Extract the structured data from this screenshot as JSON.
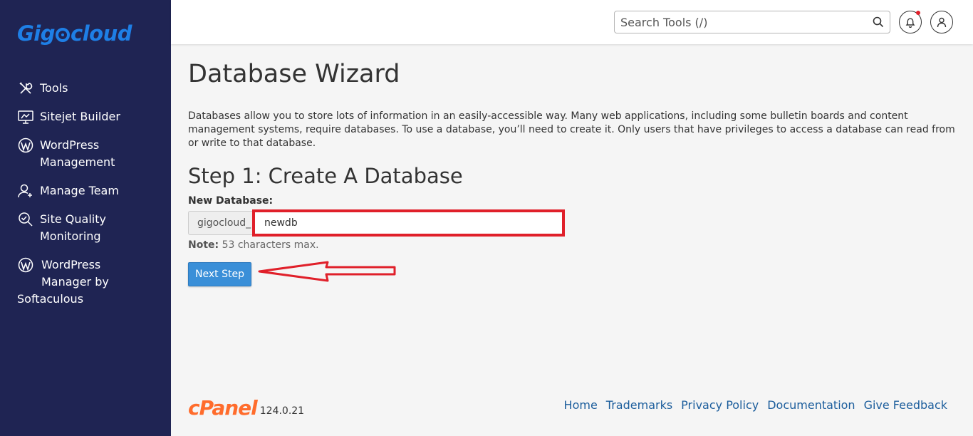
{
  "brand": {
    "logo_pre": "Gig",
    "logo_post": "cloud"
  },
  "sidebar": {
    "items": [
      {
        "label": "Tools",
        "icon": "tools-icon"
      },
      {
        "label": "Sitejet Builder",
        "icon": "sitejet-icon"
      },
      {
        "label_line1": "WordPress",
        "label_line2": "Management",
        "icon": "wordpress-icon"
      },
      {
        "label": "Manage Team",
        "icon": "manage-team-icon"
      },
      {
        "label_line1": "Site Quality",
        "label_line2": "Monitoring",
        "icon": "site-quality-icon"
      },
      {
        "label_line1": "WordPress",
        "label_line2": "Manager by",
        "label_line3": "Softaculous",
        "icon": "wordpress-icon"
      }
    ]
  },
  "header": {
    "search_placeholder": "Search Tools (/)",
    "notification_icon": "bell-icon",
    "user_icon": "user-icon",
    "notification_dot_color": "#e0202a"
  },
  "main": {
    "title": "Database Wizard",
    "description": "Databases allow you to store lots of information in an easily-accessible way. Many web applications, including some bulletin boards and content management systems, require databases. To use a database, you’ll need to create it. Only users that have privileges to access a database can read from or write to that database.",
    "step_title": "Step 1: Create A Database",
    "field_label": "New Database:",
    "prefix": "gigocloud_",
    "db_value": "newdb",
    "note_label": "Note:",
    "note_text": " 53 characters max.",
    "next_button": "Next Step"
  },
  "annotation": {
    "color": "#e0202a"
  },
  "footer": {
    "logo": "cPanel",
    "version": "124.0.21",
    "links": [
      "Home",
      "Trademarks",
      "Privacy Policy",
      "Documentation",
      "Give Feedback"
    ]
  },
  "colors": {
    "sidebar_bg": "#1f2453",
    "accent": "#3a8fd8",
    "link": "#1b5d9c",
    "cpanel": "#ff6c2c",
    "logo": "#1e7fe6"
  }
}
